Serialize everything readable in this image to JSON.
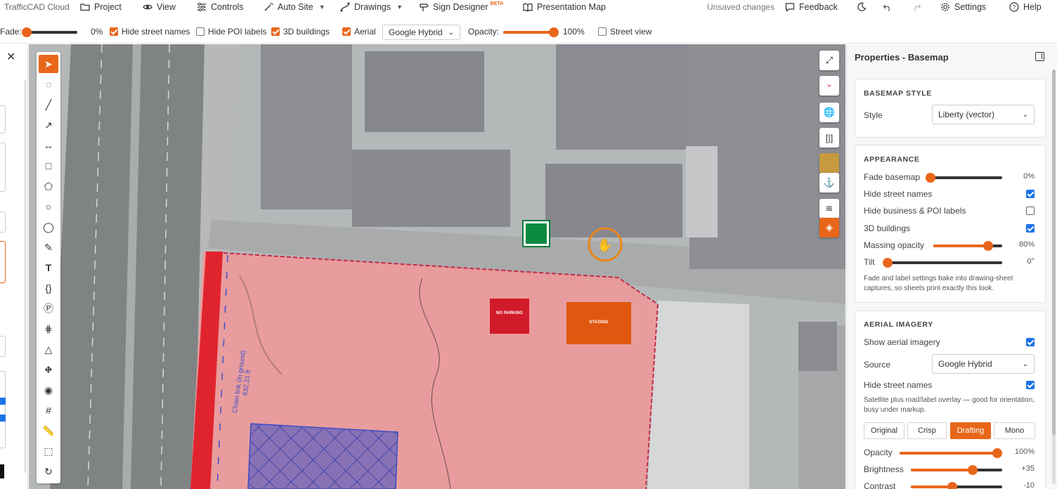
{
  "app": {
    "brand": "TrafficCAD Cloud",
    "status": "Unsaved changes"
  },
  "menu": {
    "project": "Project",
    "view": "View",
    "controls": "Controls",
    "auto_site": "Auto Site",
    "drawings": "Drawings",
    "sign_designer": "Sign Designer",
    "sign_designer_badge": "BETA",
    "presentation_map": "Presentation Map",
    "feedback": "Feedback",
    "settings": "Settings",
    "help": "Help"
  },
  "toolbar": {
    "fade_label": "Fade:",
    "fade_value": "0%",
    "fade_fraction": 0,
    "hide_street_names": {
      "label": "Hide street names",
      "checked": true
    },
    "hide_poi_labels": {
      "label": "Hide POI labels",
      "checked": false
    },
    "buildings_3d": {
      "label": "3D buildings",
      "checked": true
    },
    "aerial": {
      "label": "Aerial",
      "checked": true
    },
    "imagery_source": "Google Hybrid",
    "opacity_label": "Opacity:",
    "opacity_value": "100%",
    "opacity_fraction": 1,
    "street_view": {
      "label": "Street view",
      "checked": false
    }
  },
  "panel": {
    "title": "Properties - Basemap",
    "basemap_style": {
      "heading": "BASEMAP STYLE",
      "style_label": "Style",
      "style_value": "Liberty (vector)"
    },
    "appearance": {
      "heading": "APPEARANCE",
      "fade_label": "Fade basemap",
      "fade_value": "0%",
      "fade_fraction": 0,
      "hide_street_names": {
        "label": "Hide street names",
        "checked": true
      },
      "hide_poi": {
        "label": "Hide business & POI labels",
        "checked": false
      },
      "buildings_3d": {
        "label": "3D buildings",
        "checked": true
      },
      "massing_label": "Massing opacity",
      "massing_value": "80%",
      "massing_fraction": 0.8,
      "tilt_label": "Tilt",
      "tilt_value": "0°",
      "tilt_fraction": 0,
      "note": "Fade and label settings bake into drawing-sheet captures, so sheets print exactly this look."
    },
    "aerial_imagery": {
      "heading": "AERIAL IMAGERY",
      "show_aerial": {
        "label": "Show aerial imagery",
        "checked": true
      },
      "source_label": "Source",
      "source_value": "Google Hybrid",
      "hide_street_names": {
        "label": "Hide street names",
        "checked": true
      },
      "note": "Satellite plus road/label overlay — good for orientation, busy under markup.",
      "presets": [
        "Original",
        "Crisp",
        "Drafting",
        "Mono"
      ],
      "active_preset": "Drafting",
      "opacity_label": "Opacity",
      "opacity_value": "100%",
      "opacity_fraction": 1,
      "brightness_label": "Brightness",
      "brightness_value": "+35",
      "brightness_fraction": 0.675,
      "contrast_label": "Contrast",
      "contrast_value": "-10",
      "contrast_fraction": 0.45
    }
  },
  "map": {
    "fence_label": "Chain link (in ground)",
    "fence_length": "632.21 ft",
    "sign_red": "NO PARKING",
    "sign_orange": "STAGING"
  },
  "colors": {
    "accent": "#e8661a",
    "checkbox_blue": "#1a73e8",
    "site_fill": "#f4a0a0",
    "fence_red": "#e0242e",
    "hatch_blue": "#3a4fc8"
  }
}
